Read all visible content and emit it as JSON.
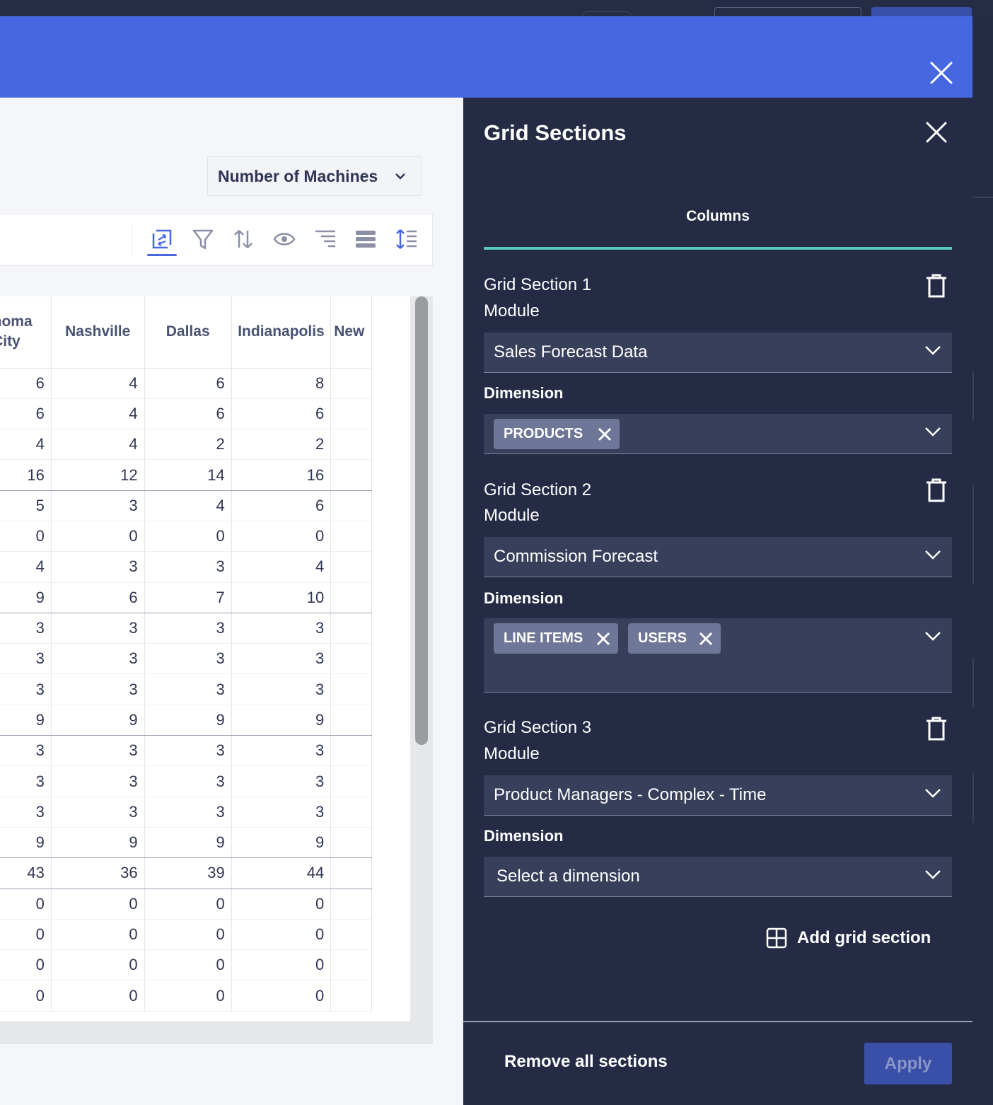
{
  "panel": {
    "title": "Grid Sections",
    "tab_label": "Columns",
    "sections": [
      {
        "title": "Grid Section 1",
        "module_label": "Module",
        "module_value": "Sales Forecast Data",
        "dimension_label": "Dimension",
        "tags": [
          "PRODUCTS"
        ]
      },
      {
        "title": "Grid Section 2",
        "module_label": "Module",
        "module_value": "Commission Forecast",
        "dimension_label": "Dimension",
        "tags": [
          "LINE ITEMS",
          "USERS"
        ]
      },
      {
        "title": "Grid Section 3",
        "module_label": "Module",
        "module_value": "Product Managers - Complex - Time",
        "dimension_label": "Dimension",
        "dimension_placeholder": "Select a dimension"
      }
    ],
    "add_label": "Add grid section",
    "remove_all_label": "Remove all sections",
    "apply_label": "Apply"
  },
  "measure_select": {
    "value": "Number of Machines"
  },
  "grid": {
    "columns": [
      "lahoma City",
      "Nashville",
      "Dallas",
      "Indianapolis",
      "New"
    ],
    "rows": [
      [
        "6",
        "4",
        "6",
        "8"
      ],
      [
        "6",
        "4",
        "6",
        "6"
      ],
      [
        "4",
        "4",
        "2",
        "2"
      ],
      [
        "16",
        "12",
        "14",
        "16"
      ],
      [
        "5",
        "3",
        "4",
        "6"
      ],
      [
        "0",
        "0",
        "0",
        "0"
      ],
      [
        "4",
        "3",
        "3",
        "4"
      ],
      [
        "9",
        "6",
        "7",
        "10"
      ],
      [
        "3",
        "3",
        "3",
        "3"
      ],
      [
        "3",
        "3",
        "3",
        "3"
      ],
      [
        "3",
        "3",
        "3",
        "3"
      ],
      [
        "9",
        "9",
        "9",
        "9"
      ],
      [
        "3",
        "3",
        "3",
        "3"
      ],
      [
        "3",
        "3",
        "3",
        "3"
      ],
      [
        "3",
        "3",
        "3",
        "3"
      ],
      [
        "9",
        "9",
        "9",
        "9"
      ],
      [
        "43",
        "36",
        "39",
        "44"
      ],
      [
        "0",
        "0",
        "0",
        "0"
      ],
      [
        "0",
        "0",
        "0",
        "0"
      ],
      [
        "0",
        "0",
        "0",
        "0"
      ],
      [
        "0",
        "0",
        "0",
        "0"
      ]
    ]
  },
  "colors": {
    "header_blue": "#4767e1",
    "panel_bg": "#252b45",
    "tab_accent": "#58c9b9",
    "apply_bg": "#3a4fa8"
  }
}
